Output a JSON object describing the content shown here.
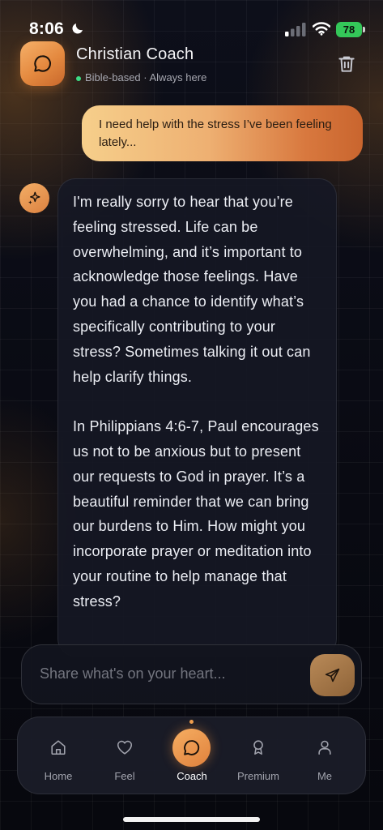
{
  "status_bar": {
    "time": "8:06",
    "battery": "78",
    "icons": [
      "moon-icon",
      "signal-icon",
      "wifi-icon",
      "battery-icon"
    ]
  },
  "header": {
    "title": "Christian Coach",
    "subtitle": "Bible-based · Always here",
    "logo_icon": "chat-bubble-icon",
    "action_icon": "trash-icon"
  },
  "messages": [
    {
      "role": "user",
      "text": "I need help with the stress I’ve been feeling lately..."
    },
    {
      "role": "assistant",
      "avatar_icon": "sparkles-icon",
      "text": "I'm really sorry to hear that you’re feeling stressed. Life can be overwhelming, and it’s important to acknowledge those feelings. Have you had a chance to identify what’s specifically contributing to your stress? Sometimes talking it out can help clarify things.\n\nIn Philippians 4:6-7, Paul encourages us not to be anxious but to present our requests to God in prayer. It’s a beautiful reminder that we can bring our burdens to Him. How might you incorporate prayer or meditation into your routine to help manage that stress?"
    }
  ],
  "composer": {
    "placeholder": "Share what's on your heart...",
    "value": "",
    "send_icon": "send-icon"
  },
  "nav": {
    "active": "Coach",
    "items": [
      {
        "label": "Home",
        "icon": "home-icon"
      },
      {
        "label": "Feel",
        "icon": "heart-icon"
      },
      {
        "label": "Coach",
        "icon": "chat-bubble-icon"
      },
      {
        "label": "Premium",
        "icon": "award-icon"
      },
      {
        "label": "Me",
        "icon": "user-icon"
      }
    ]
  },
  "colors": {
    "accent": "#E8893F",
    "accent_light": "#F6CF8B",
    "online": "#3DDC84",
    "battery": "#34C759",
    "background": "#0A0B14"
  }
}
